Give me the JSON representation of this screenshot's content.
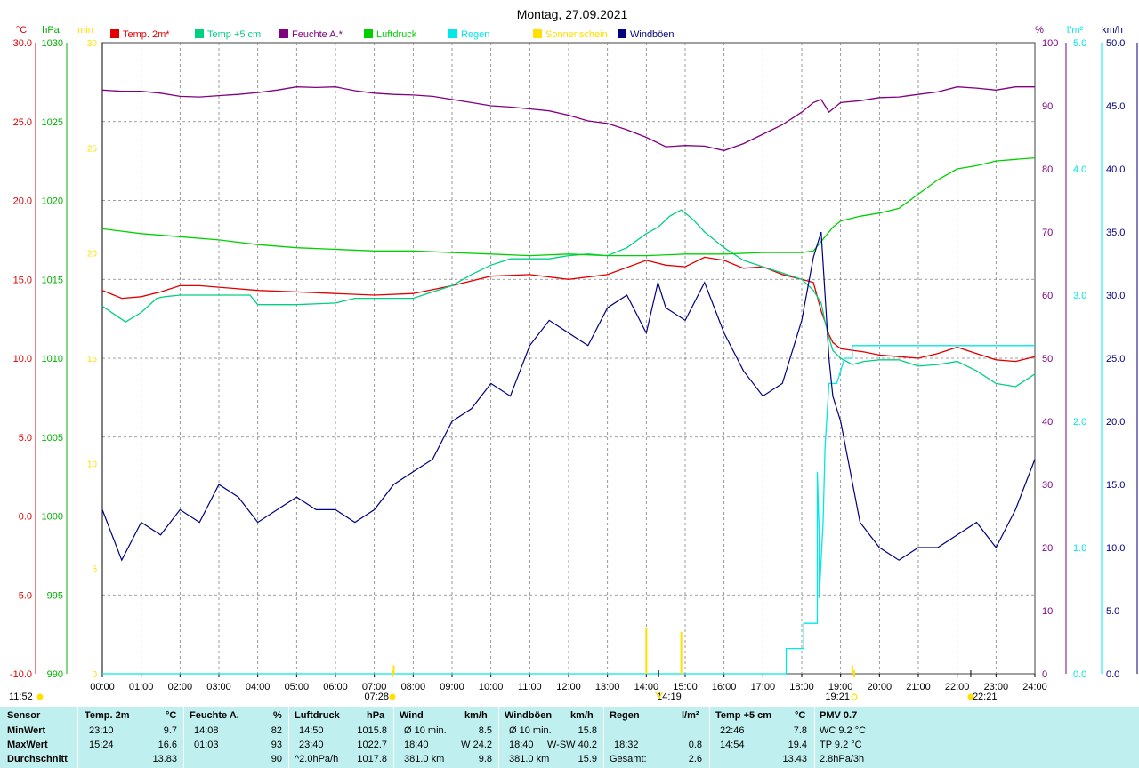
{
  "title": "Montag, 27.09.2021",
  "colors": {
    "temp2m": "#e00000",
    "temp5cm": "#00d080",
    "feuchte": "#800080",
    "luftdruck": "#00d000",
    "regen": "#00e8e8",
    "sonne": "#ffe000",
    "wind": "#000080",
    "grid": "#808080",
    "stats_bg": "#bfefef"
  },
  "legend": [
    {
      "label": "Temp. 2m*",
      "color": "#e00000"
    },
    {
      "label": "Temp +5 cm",
      "color": "#00d080"
    },
    {
      "label": "Feuchte A.*",
      "color": "#800080"
    },
    {
      "label": "Luftdruck",
      "color": "#00d000"
    },
    {
      "label": "Regen",
      "color": "#00e8e8"
    },
    {
      "label": "Sonnenschein",
      "color": "#ffe000"
    },
    {
      "label": "Windböen",
      "color": "#000080"
    }
  ],
  "axes": {
    "temp": {
      "unit": "°C",
      "color": "#e00000",
      "ticks": [
        "30.0",
        "25.0",
        "20.0",
        "15.0",
        "10.0",
        "5.0",
        "0.0",
        "-5.0",
        "-10.0"
      ]
    },
    "pressure": {
      "unit": "hPa",
      "color": "#00b000",
      "ticks": [
        "1030",
        "1025",
        "1020",
        "1015",
        "1010",
        "1005",
        "1000",
        "995",
        "990"
      ]
    },
    "sun_min": {
      "unit": "min",
      "color": "#ffe000",
      "ticks": [
        "30",
        "25",
        "20",
        "15",
        "10",
        "5",
        "0"
      ]
    },
    "humidity": {
      "unit": "%",
      "color": "#800080",
      "ticks": [
        "100",
        "90",
        "80",
        "70",
        "60",
        "50",
        "40",
        "30",
        "20",
        "10",
        "0"
      ]
    },
    "rain": {
      "unit": "l/m²",
      "color": "#00e8e8",
      "ticks": [
        "5.0",
        "4.0",
        "3.0",
        "2.0",
        "1.0",
        "0.0"
      ]
    },
    "wind": {
      "unit": "km/h",
      "color": "#000080",
      "ticks": [
        "50.0",
        "45.0",
        "40.0",
        "35.0",
        "30.0",
        "25.0",
        "20.0",
        "15.0",
        "10.0",
        "5.0",
        "0.0"
      ]
    }
  },
  "time_ticks": [
    "00:00",
    "01:00",
    "02:00",
    "03:00",
    "04:00",
    "05:00",
    "06:00",
    "07:00",
    "08:00",
    "09:00",
    "10:00",
    "11:00",
    "12:00",
    "13:00",
    "14:00",
    "15:00",
    "16:00",
    "17:00",
    "18:00",
    "19:00",
    "20:00",
    "21:00",
    "22:00",
    "23:00",
    "24:00"
  ],
  "events": {
    "moonset": "11:52",
    "sunrise": "07:28",
    "low_sun": "14:19",
    "sunset": "19:21",
    "moonrise": "22:21"
  },
  "chart_data": {
    "type": "line",
    "x_unit": "hour",
    "xlim": [
      0,
      24
    ],
    "series": [
      {
        "name": "Temp. 2m*",
        "axis": "temp",
        "ylim": [
          -10,
          30
        ],
        "x": [
          0,
          0.5,
          1,
          1.5,
          2,
          2.5,
          3,
          4,
          5,
          6,
          7,
          8,
          9,
          10,
          11,
          12,
          13,
          14,
          14.5,
          15,
          15.5,
          16,
          16.5,
          17,
          17.5,
          18,
          18.3,
          18.5,
          18.6,
          18.7,
          18.8,
          19,
          19.3,
          19.6,
          20,
          20.5,
          21,
          21.5,
          22,
          22.5,
          23,
          23.5,
          24
        ],
        "y": [
          14.3,
          13.8,
          13.9,
          14.2,
          14.6,
          14.6,
          14.5,
          14.3,
          14.2,
          14.1,
          14.0,
          14.1,
          14.6,
          15.2,
          15.3,
          15.0,
          15.3,
          16.2,
          15.9,
          15.8,
          16.4,
          16.2,
          15.7,
          15.8,
          15.3,
          15.0,
          14.8,
          13.0,
          12.3,
          11.5,
          11.0,
          10.6,
          10.5,
          10.4,
          10.2,
          10.1,
          10.0,
          10.3,
          10.7,
          10.3,
          9.9,
          9.8,
          10.1
        ]
      },
      {
        "name": "Temp +5 cm",
        "axis": "temp",
        "ylim": [
          -10,
          30
        ],
        "x": [
          0,
          0.3,
          0.6,
          1,
          1.4,
          1.6,
          2,
          3,
          3.8,
          4,
          5,
          6,
          6.5,
          7,
          7.5,
          8,
          8.5,
          9,
          9.5,
          10,
          10.5,
          11,
          11.5,
          12,
          12.5,
          13,
          13.5,
          14,
          14.3,
          14.6,
          14.9,
          15.2,
          15.5,
          16,
          16.5,
          17,
          17.5,
          18,
          18.3,
          18.5,
          18.6,
          18.7,
          18.8,
          19,
          19.3,
          19.6,
          20,
          20.5,
          21,
          21.5,
          22,
          22.5,
          23,
          23.5,
          24
        ],
        "y": [
          13.3,
          12.8,
          12.3,
          12.9,
          13.8,
          13.9,
          14.0,
          14.0,
          14.0,
          13.4,
          13.4,
          13.5,
          13.8,
          13.8,
          13.8,
          13.8,
          14.2,
          14.6,
          15.3,
          15.9,
          16.3,
          16.3,
          16.3,
          16.5,
          16.6,
          16.5,
          17.0,
          17.9,
          18.3,
          19.0,
          19.4,
          18.8,
          18.0,
          17.0,
          16.2,
          15.8,
          15.4,
          15.0,
          14.3,
          13.5,
          12.3,
          11.3,
          10.5,
          10.0,
          9.6,
          9.8,
          9.9,
          9.9,
          9.5,
          9.6,
          9.8,
          9.2,
          8.4,
          8.2,
          9.0
        ]
      },
      {
        "name": "Feuchte A.*",
        "axis": "humidity",
        "ylim": [
          0,
          100
        ],
        "x": [
          0,
          0.5,
          1,
          1.5,
          2,
          2.5,
          3,
          3.5,
          4,
          4.5,
          5,
          5.5,
          6,
          6.5,
          7,
          7.5,
          8,
          8.5,
          9,
          9.5,
          10,
          10.5,
          11,
          11.5,
          12,
          12.5,
          13,
          13.5,
          14,
          14.5,
          15,
          15.5,
          16,
          16.5,
          17,
          17.5,
          18,
          18.3,
          18.5,
          18.7,
          19,
          19.5,
          20,
          20.5,
          21,
          21.5,
          22,
          22.5,
          23,
          23.5,
          24
        ],
        "y": [
          92.5,
          92.3,
          92.3,
          92.0,
          91.5,
          91.4,
          91.6,
          91.8,
          92.1,
          92.5,
          93.0,
          92.9,
          93.0,
          92.4,
          92.0,
          91.8,
          91.7,
          91.5,
          91.0,
          90.5,
          90.0,
          89.8,
          89.5,
          89.2,
          88.5,
          87.6,
          87.2,
          86.2,
          85.0,
          83.5,
          83.7,
          83.6,
          82.9,
          84.0,
          85.5,
          87.0,
          89.0,
          90.5,
          91.0,
          89.0,
          90.5,
          90.8,
          91.3,
          91.4,
          91.8,
          92.2,
          93.0,
          92.8,
          92.5,
          93.0,
          93.0
        ]
      },
      {
        "name": "Luftdruck",
        "axis": "pressure",
        "ylim": [
          990,
          1030
        ],
        "x": [
          0,
          1,
          2,
          3,
          4,
          5,
          6,
          7,
          8,
          9,
          10,
          11,
          12,
          13,
          14,
          15,
          16,
          17,
          18,
          18.3,
          18.5,
          18.8,
          19,
          19.5,
          20,
          20.5,
          21,
          21.5,
          22,
          22.5,
          23,
          23.5,
          24
        ],
        "y": [
          1018.2,
          1017.9,
          1017.7,
          1017.5,
          1017.2,
          1017.0,
          1016.9,
          1016.8,
          1016.8,
          1016.7,
          1016.6,
          1016.5,
          1016.6,
          1016.5,
          1016.5,
          1016.6,
          1016.6,
          1016.7,
          1016.7,
          1016.8,
          1017.4,
          1018.3,
          1018.7,
          1019.0,
          1019.2,
          1019.5,
          1020.4,
          1021.3,
          1022.0,
          1022.2,
          1022.5,
          1022.6,
          1022.7
        ]
      },
      {
        "name": "Regen",
        "axis": "rain",
        "ylim": [
          0,
          5
        ],
        "x": [
          0,
          17.6,
          17.6,
          17.9,
          17.9,
          18.05,
          18.05,
          18.4,
          18.4,
          18.45,
          18.45,
          18.55,
          18.6,
          18.7,
          18.8,
          18.9,
          19.0,
          19.1,
          19.3,
          19.3,
          24
        ],
        "y": [
          0,
          0,
          0.2,
          0.2,
          0.2,
          0.2,
          0.4,
          0.4,
          1.6,
          1.1,
          0.6,
          1.2,
          1.8,
          2.3,
          2.3,
          2.3,
          2.4,
          2.5,
          2.5,
          2.6,
          2.6
        ]
      },
      {
        "name": "Sonnenschein",
        "axis": "sun_min",
        "ylim": [
          0,
          30
        ],
        "type": "bar",
        "x": [
          7.5,
          14.0,
          14.9,
          19.3
        ],
        "y": [
          0.4,
          2.2,
          2.0,
          0.4
        ]
      },
      {
        "name": "Windböen",
        "axis": "wind",
        "ylim": [
          0,
          50
        ],
        "x": [
          0,
          0.5,
          1,
          1.5,
          2,
          2.5,
          3,
          3.5,
          4,
          4.5,
          5,
          5.5,
          6,
          6.5,
          7,
          7.5,
          8,
          8.5,
          9,
          9.5,
          10,
          10.5,
          11,
          11.5,
          12,
          12.5,
          13,
          13.5,
          14,
          14.3,
          14.5,
          15,
          15.5,
          16,
          16.5,
          17,
          17.5,
          18,
          18.3,
          18.5,
          18.6,
          18.7,
          18.8,
          19,
          19.5,
          20,
          20.5,
          21,
          21.5,
          22,
          22.5,
          23,
          23.5,
          24
        ],
        "y": [
          13,
          9,
          12,
          11,
          13,
          12,
          15,
          14,
          12,
          13,
          14,
          13,
          13,
          12,
          13,
          15,
          16,
          17,
          20,
          21,
          23,
          22,
          26,
          28,
          27,
          26,
          29,
          30,
          27,
          31,
          29,
          28,
          31,
          27,
          24,
          22,
          23,
          28,
          33,
          35,
          30,
          25,
          22,
          20,
          12,
          10,
          9,
          10,
          10,
          11,
          12,
          10,
          13,
          17
        ]
      }
    ]
  },
  "stats": {
    "headers": [
      {
        "name": "Sensor",
        "unit": ""
      },
      {
        "name": "Temp. 2m",
        "unit": "°C"
      },
      {
        "name": "Feuchte A.",
        "unit": "%"
      },
      {
        "name": "Luftdruck",
        "unit": "hPa"
      },
      {
        "name": "Wind",
        "unit": "km/h"
      },
      {
        "name": "Windböen",
        "unit": "km/h"
      },
      {
        "name": "Regen",
        "unit": "l/m²"
      },
      {
        "name": "Temp +5 cm",
        "unit": "°C"
      },
      {
        "name": "PMV 0.7",
        "unit": ""
      }
    ],
    "row_labels": [
      "MinWert",
      "MaxWert",
      "Durchschnitt"
    ],
    "temp2m": [
      [
        "23:10",
        "9.7"
      ],
      [
        "15:24",
        "16.6"
      ],
      [
        "",
        "13.83"
      ]
    ],
    "feuchte": [
      [
        "14:08",
        "82"
      ],
      [
        "01:03",
        "93"
      ],
      [
        "",
        "90"
      ]
    ],
    "luftdruck": [
      [
        "14:50",
        "1015.8"
      ],
      [
        "23:40",
        "1022.7"
      ],
      [
        "^2.0hPa/h",
        "1017.8"
      ]
    ],
    "wind": [
      [
        "Ø 10 min.",
        "8.5"
      ],
      [
        "18:40",
        "W 24.2"
      ],
      [
        "381.0 km",
        "9.8"
      ]
    ],
    "windboeen": [
      [
        "Ø 10 min.",
        "15.8"
      ],
      [
        "18:40",
        "W-SW 40.2"
      ],
      [
        "381.0 km",
        "15.9"
      ]
    ],
    "regen": [
      [
        "",
        ""
      ],
      [
        "18:32",
        "0.8"
      ],
      [
        "Gesamt:",
        "2.6"
      ]
    ],
    "temp5cm": [
      [
        "22:46",
        "7.8"
      ],
      [
        "14:54",
        "19.4"
      ],
      [
        "",
        "13.43"
      ]
    ],
    "pmv": [
      "WC 9.2 °C",
      "TP 9.2 °C",
      "2.8hPa/3h"
    ]
  }
}
